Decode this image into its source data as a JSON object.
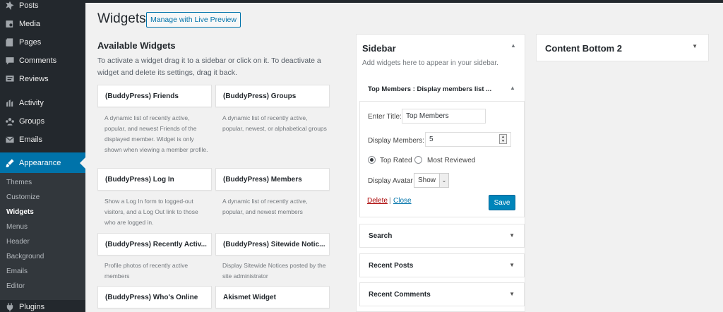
{
  "menu": {
    "posts": "Posts",
    "media": "Media",
    "pages": "Pages",
    "comments": "Comments",
    "reviews": "Reviews",
    "activity": "Activity",
    "groups": "Groups",
    "emails": "Emails",
    "appearance": "Appearance",
    "plugins": "Plugins"
  },
  "submenu": {
    "themes": "Themes",
    "customize": "Customize",
    "widgets": "Widgets",
    "menus": "Menus",
    "header": "Header",
    "background": "Background",
    "emails": "Emails",
    "editor": "Editor"
  },
  "header": {
    "title": "Widgets",
    "live_preview": "Manage with Live Preview"
  },
  "available": {
    "title": "Available Widgets",
    "description": "To activate a widget drag it to a sidebar or click on it. To deactivate a widget and delete its settings, drag it back.",
    "widgets": [
      {
        "name": "(BuddyPress) Friends",
        "desc": "A dynamic list of recently active, popular, and newest Friends of the displayed member. Widget is only shown when viewing a member profile."
      },
      {
        "name": "(BuddyPress) Groups",
        "desc": "A dynamic list of recently active, popular, newest, or alphabetical groups"
      },
      {
        "name": "(BuddyPress) Log In",
        "desc": "Show a Log In form to logged-out visitors, and a Log Out link to those who are logged in."
      },
      {
        "name": "(BuddyPress) Members",
        "desc": "A dynamic list of recently active, popular, and newest members"
      },
      {
        "name": "(BuddyPress) Recently Activ...",
        "desc": "Profile photos of recently active members"
      },
      {
        "name": "(BuddyPress) Sitewide Notic...",
        "desc": "Display Sitewide Notices posted by the site administrator"
      },
      {
        "name": "(BuddyPress) Who's Online",
        "desc": ""
      },
      {
        "name": "Akismet Widget",
        "desc": ""
      }
    ]
  },
  "sidebar": {
    "title": "Sidebar",
    "description": "Add widgets here to appear in your sidebar.",
    "top_members": {
      "title": "Top Members : Display members list ...",
      "enter_title_label": "Enter Title:",
      "title_value": "Top Members",
      "display_members_label": "Display Members:",
      "display_members_value": "5",
      "radio_top_rated": "Top Rated",
      "radio_most_reviewed": "Most Reviewed",
      "display_avatar_label": "Display Avatar",
      "display_avatar_value": "Show",
      "delete": "Delete",
      "separator": "|",
      "close": "Close",
      "save": "Save"
    },
    "collapsed": [
      {
        "title": "Search"
      },
      {
        "title": "Recent Posts"
      },
      {
        "title": "Recent Comments"
      }
    ]
  },
  "content_bottom": {
    "title": "Content Bottom 2"
  },
  "icons": {
    "up": "▲",
    "down": "▼",
    "select_arrow": "⌄"
  }
}
